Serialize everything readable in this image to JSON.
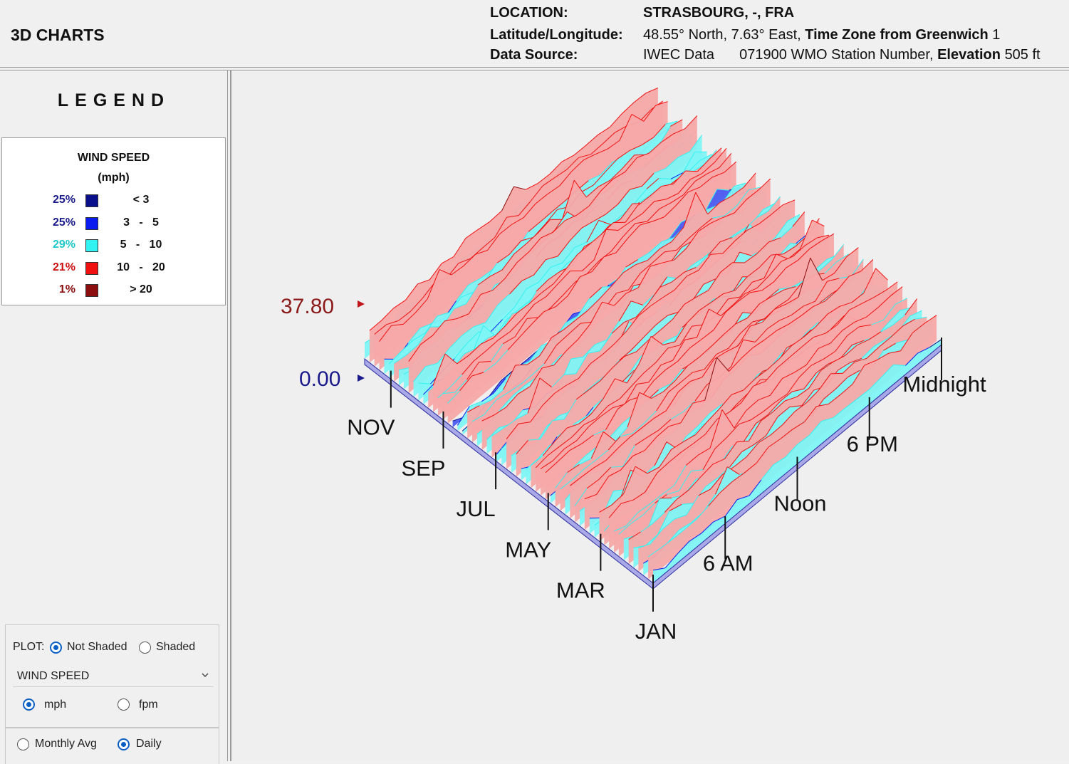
{
  "header": {
    "title": "3D CHARTS",
    "location_label": "LOCATION:",
    "location_value": "STRASBOURG, -, FRA",
    "latlon_label": "Latitude/Longitude:",
    "latlon_value": "48.55° North, 7.63° East,",
    "tz_label": "Time Zone from Greenwich",
    "tz_value": "1",
    "source_label": "Data Source:",
    "source_value": "IWEC Data",
    "station_value": "071900 WMO Station Number,",
    "elevation_label": "Elevation",
    "elevation_value": "505 ft"
  },
  "legend": {
    "title": "LEGEND",
    "heading_line1": "WIND SPEED",
    "heading_line2": "(mph)",
    "items": [
      {
        "pct": "25%",
        "range": "< 3",
        "color": "#0a108c",
        "text_color": "#1a1a8c"
      },
      {
        "pct": "25%",
        "range": "3   -   5",
        "color": "#0a1cf0",
        "text_color": "#1a1a8c"
      },
      {
        "pct": "29%",
        "range": "5   -   10",
        "color": "#33f2f2",
        "text_color": "#1ec8c8"
      },
      {
        "pct": "21%",
        "range": "10   -   20",
        "color": "#f01010",
        "text_color": "#cc1010"
      },
      {
        "pct": "1%",
        "range": "> 20",
        "color": "#8c0e0e",
        "text_color": "#8c0e0e"
      }
    ]
  },
  "controls": {
    "plot_label": "PLOT:",
    "not_shaded_label": "Not Shaded",
    "shaded_label": "Shaded",
    "plot_selected": "Not Shaded",
    "metric_selected": "WIND SPEED",
    "unit_mph_label": "mph",
    "unit_fpm_label": "fpm",
    "unit_selected": "mph",
    "monthly_avg_label": "Monthly Avg",
    "daily_label": "Daily",
    "period_selected": "Daily",
    "icons": {
      "dropdown": "chevron-down-icon"
    }
  },
  "chart_data": {
    "type": "surface-3d",
    "metric": "WIND SPEED",
    "unit": "mph",
    "z_max_label": "37.80",
    "z_min_label": "0.00",
    "zlim": [
      0,
      37.8
    ],
    "month_ticks": [
      "JAN",
      "MAR",
      "MAY",
      "JUL",
      "SEP",
      "NOV"
    ],
    "hour_ticks": [
      "6 AM",
      "Noon",
      "6 PM",
      "Midnight"
    ],
    "band_colors": {
      "below_3": "#0a108c",
      "3_to_5": "#0a1cf0",
      "5_to_10": "#33f2f2",
      "10_to_20": "#f01010",
      "above_20": "#8c0e0e"
    },
    "band_shares_pct": {
      "below_3": 25,
      "3_to_5": 25,
      "5_to_10": 29,
      "10_to_20": 21,
      "above_20": 1
    }
  }
}
